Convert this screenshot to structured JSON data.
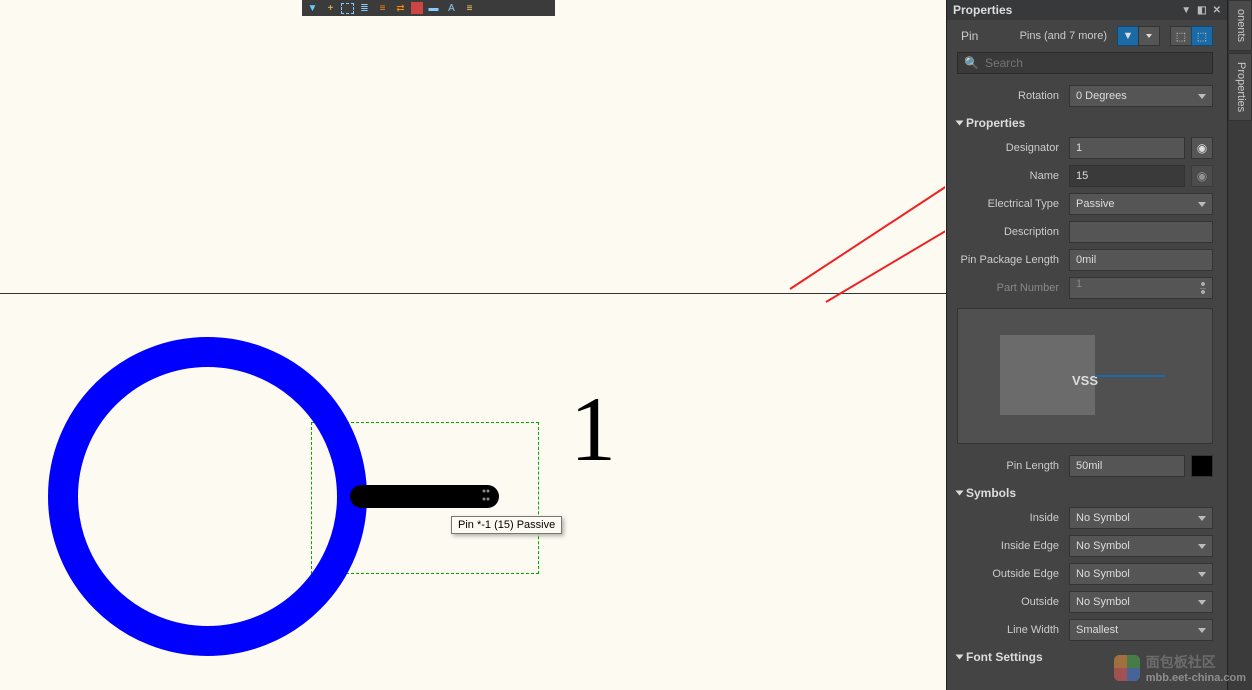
{
  "canvas": {
    "pin_display_number": "1",
    "tooltip": "Pin *-1 (15) Passive"
  },
  "toolbar_icons": [
    "filter",
    "plus",
    "rect",
    "align",
    "center",
    "swap",
    "color",
    "table",
    "text",
    "list"
  ],
  "panel": {
    "title": "Properties",
    "object_type": "Pin",
    "scope": "Pins (and 7 more)",
    "search_placeholder": "Search",
    "rotation_label": "Rotation",
    "rotation_value": "0 Degrees",
    "section_properties": "Properties",
    "designator_label": "Designator",
    "designator_value": "1",
    "name_label": "Name",
    "name_value": "15",
    "electrical_type_label": "Electrical Type",
    "electrical_type_value": "Passive",
    "description_label": "Description",
    "description_value": "",
    "ppl_label": "Pin Package Length",
    "ppl_value": "0mil",
    "partnum_label": "Part Number",
    "partnum_value": "1",
    "preview_label": "VSS",
    "pin_length_label": "Pin Length",
    "pin_length_value": "50mil",
    "section_symbols": "Symbols",
    "inside_label": "Inside",
    "inside_value": "No Symbol",
    "inside_edge_label": "Inside Edge",
    "inside_edge_value": "No Symbol",
    "outside_edge_label": "Outside Edge",
    "outside_edge_value": "No Symbol",
    "outside_label": "Outside",
    "outside_value": "No Symbol",
    "line_width_label": "Line Width",
    "line_width_value": "Smallest",
    "section_font": "Font Settings"
  },
  "sidetabs": [
    "onents",
    "Properties"
  ],
  "watermark": {
    "line1": "面包板社区",
    "line2": "mbb.eet-china.com"
  }
}
